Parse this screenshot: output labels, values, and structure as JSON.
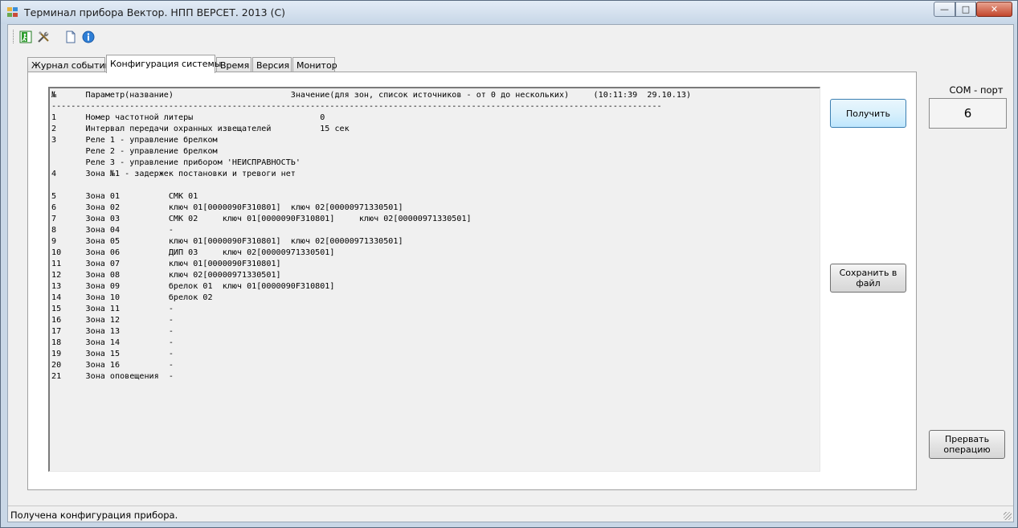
{
  "window": {
    "title": "Терминал прибора Вектор. НПП ВЕРСЕТ. 2013 (С)",
    "controls": {
      "minimize": "—",
      "maximize": "□",
      "close": "✕"
    }
  },
  "toolbar": {
    "icons": [
      "exit-icon",
      "tools-icon",
      "document-icon",
      "info-icon"
    ]
  },
  "tabs": [
    {
      "label": "Журнал событий"
    },
    {
      "label": "Конфигурация системы",
      "active": true
    },
    {
      "label": "Время"
    },
    {
      "label": "Версия"
    },
    {
      "label": "Монитор"
    }
  ],
  "config_text": {
    "header": "№      Параметр(название)                        Значение(для зон, список источников - от 0 до нескольких)     (10:11:39  29.10.13)",
    "separator": "-----------------------------------------------------------------------------------------------------------------------------",
    "lines": [
      "1      Номер частотной литеры                          0",
      "2      Интервал передачи охранных извещателей          15 сек",
      "3      Реле 1 - управление брелком",
      "       Реле 2 - управление брелком",
      "       Реле 3 - управление прибором 'НЕИСПРАВНОСТЬ'",
      "4      Зона №1 - задержек постановки и тревоги нет",
      "",
      "5      Зона 01          СМК 01",
      "6      Зона 02          ключ 01[0000090F310801]  ключ 02[00000971330501]",
      "7      Зона 03          СМК 02     ключ 01[0000090F310801]     ключ 02[00000971330501]",
      "8      Зона 04          -",
      "9      Зона 05          ключ 01[0000090F310801]  ключ 02[00000971330501]",
      "10     Зона 06          ДИП 03     ключ 02[00000971330501]",
      "11     Зона 07          ключ 01[0000090F310801]",
      "12     Зона 08          ключ 02[00000971330501]",
      "13     Зона 09          брелок 01  ключ 01[0000090F310801]",
      "14     Зона 10          брелок 02",
      "15     Зона 11          -",
      "16     Зона 12          -",
      "17     Зона 13          -",
      "18     Зона 14          -",
      "19     Зона 15          -",
      "20     Зона 16          -",
      "21     Зона оповещения  -"
    ]
  },
  "buttons": {
    "get": "Получить",
    "save": "Сохранить в файл",
    "abort": "Прервать операцию"
  },
  "com_port": {
    "label": "COM - порт",
    "value": "6"
  },
  "status": {
    "text": "Получена конфигурация прибора."
  }
}
